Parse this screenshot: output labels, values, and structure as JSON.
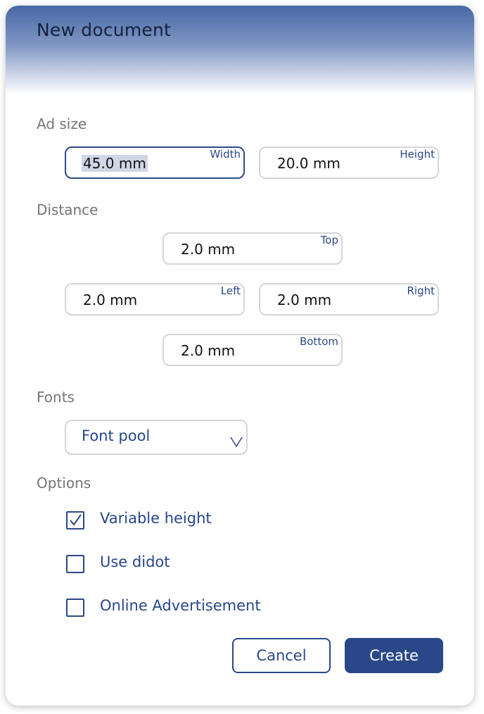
{
  "dialog": {
    "title": "New document"
  },
  "ad_size": {
    "label": "Ad size",
    "width": {
      "value": "45.0 mm",
      "caption": "Width"
    },
    "height": {
      "value": "20.0 mm",
      "caption": "Height"
    }
  },
  "distance": {
    "label": "Distance",
    "top": {
      "value": "2.0 mm",
      "caption": "Top"
    },
    "left": {
      "value": "2.0 mm",
      "caption": "Left"
    },
    "right": {
      "value": "2.0 mm",
      "caption": "Right"
    },
    "bottom": {
      "value": "2.0 mm",
      "caption": "Bottom"
    }
  },
  "fonts": {
    "label": "Fonts",
    "selected": "Font pool",
    "chevron_icon": "chevron-down-icon"
  },
  "options": {
    "label": "Options",
    "items": [
      {
        "label": "Variable height",
        "checked": true
      },
      {
        "label": "Use didot",
        "checked": false
      },
      {
        "label": "Online Advertisement",
        "checked": false
      }
    ]
  },
  "buttons": {
    "cancel": "Cancel",
    "create": "Create"
  },
  "colors": {
    "accent": "#2a4888",
    "header_gradient_top": "#4767a6",
    "section_label": "#757575",
    "field_border": "#d6d6d6"
  }
}
